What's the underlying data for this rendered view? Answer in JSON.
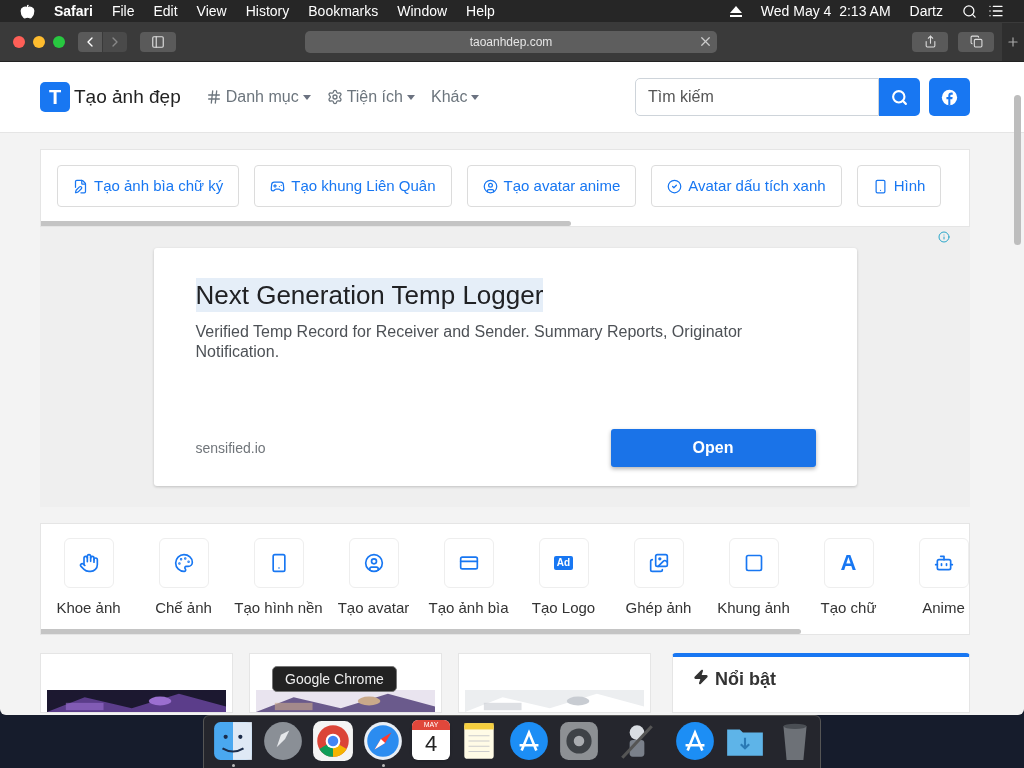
{
  "menubar": {
    "app": "Safari",
    "menus": [
      "File",
      "Edit",
      "View",
      "History",
      "Bookmarks",
      "Window",
      "Help"
    ],
    "date": "Wed May 4",
    "time": "2:13 AM",
    "user": "Dartz"
  },
  "browser": {
    "url": "taoanhdep.com"
  },
  "site": {
    "logo_letter": "T",
    "logo_text": "Tạo ảnh đẹp",
    "nav": [
      {
        "label": "Danh mục",
        "kind": "hash"
      },
      {
        "label": "Tiện ích",
        "kind": "gears"
      },
      {
        "label": "Khác",
        "kind": "plain"
      }
    ],
    "search_placeholder": "Tìm kiếm"
  },
  "quick_links": [
    {
      "label": "Tạo ảnh bìa chữ ký",
      "kind": "signature"
    },
    {
      "label": "Tạo khung Liên Quân",
      "kind": "gamepad"
    },
    {
      "label": "Tạo avatar anime",
      "kind": "user"
    },
    {
      "label": "Avatar dấu tích xanh",
      "kind": "check"
    },
    {
      "label": "Hình",
      "kind": "phone"
    }
  ],
  "ad": {
    "title": "Next Generation Temp Logger",
    "body": "Verified Temp Record for Receiver and Sender. Summary Reports, Originator Notification.",
    "source": "sensified.io",
    "button": "Open"
  },
  "categories": [
    {
      "label": "Khoe ảnh",
      "kind": "hand"
    },
    {
      "label": "Chế ảnh",
      "kind": "palette"
    },
    {
      "label": "Tạo hình nền",
      "kind": "phone"
    },
    {
      "label": "Tạo avatar",
      "kind": "user"
    },
    {
      "label": "Tạo ảnh bìa",
      "kind": "card"
    },
    {
      "label": "Tạo Logo",
      "kind": "text",
      "glyph": "Ad"
    },
    {
      "label": "Ghép ảnh",
      "kind": "images"
    },
    {
      "label": "Khung ảnh",
      "kind": "frame"
    },
    {
      "label": "Tạo chữ",
      "kind": "letter",
      "glyph": "A"
    },
    {
      "label": "Anime",
      "kind": "bot"
    }
  ],
  "featured": {
    "title": "Nổi bật"
  },
  "dock": {
    "tooltip": "Google Chrome",
    "items": [
      {
        "kind": "finder",
        "running": true
      },
      {
        "kind": "launchpad",
        "running": false
      },
      {
        "kind": "chrome",
        "running": false
      },
      {
        "kind": "safari",
        "running": true
      },
      {
        "kind": "calendar",
        "running": false,
        "month": "MAY",
        "day": "4"
      },
      {
        "kind": "notes",
        "running": false
      },
      {
        "kind": "appstore",
        "running": false
      },
      {
        "kind": "settings",
        "running": false
      },
      {
        "kind": "automator",
        "running": false
      },
      {
        "kind": "appstore",
        "running": false
      },
      {
        "kind": "folder",
        "running": false
      },
      {
        "kind": "trash",
        "running": false
      }
    ]
  }
}
